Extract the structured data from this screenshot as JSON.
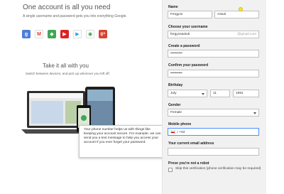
{
  "left": {
    "headline": "One account is all you need",
    "subline": "A single username and password gets you into everything Google.",
    "apps": [
      {
        "icon": "google-search-icon",
        "glyph": "g",
        "color": "#4d7fd8"
      },
      {
        "icon": "gmail-icon",
        "glyph": "M",
        "color": "#d8402f"
      },
      {
        "icon": "maps-icon",
        "glyph": "◆",
        "color": "#3fa757"
      },
      {
        "icon": "youtube-icon",
        "glyph": "▶",
        "color": "#e02020"
      },
      {
        "icon": "play-store-icon",
        "glyph": "▶",
        "color": "#22a1e5"
      },
      {
        "icon": "chrome-icon",
        "glyph": "◉",
        "color": "#2e9f46"
      },
      {
        "icon": "google-plus-icon",
        "glyph": "g+",
        "color": "#d8422f"
      }
    ],
    "headline2": "Take it all with you",
    "subline2": "Switch between devices, and pick up wherever you left off."
  },
  "tooltip": {
    "text": "Your phone number helps us with things like keeping your account secure. For example, we can send you a text message to help you access your account if you ever forget your password."
  },
  "form": {
    "name_label": "Name",
    "first_name": "Fergyos",
    "last_name": "Astuti",
    "username_label": "Choose your username",
    "username": "fergyosastuti",
    "username_suffix": "@gmail.com",
    "password_label": "Create a password",
    "password": "••••••••••",
    "confirm_label": "Confirm your password",
    "confirm": "••••••••••",
    "birthday_label": "Birthday",
    "birth_month": "July",
    "birth_day": "11",
    "birth_year": "1991",
    "gender_label": "Gender",
    "gender": "Female",
    "phone_label": "Mobile phone",
    "phone_value": "+62",
    "email_label": "Your current email address",
    "email_value": "",
    "robot_label": "Prove you're not a robot",
    "skip_text": "Skip this verification (phone verification may be required)"
  }
}
